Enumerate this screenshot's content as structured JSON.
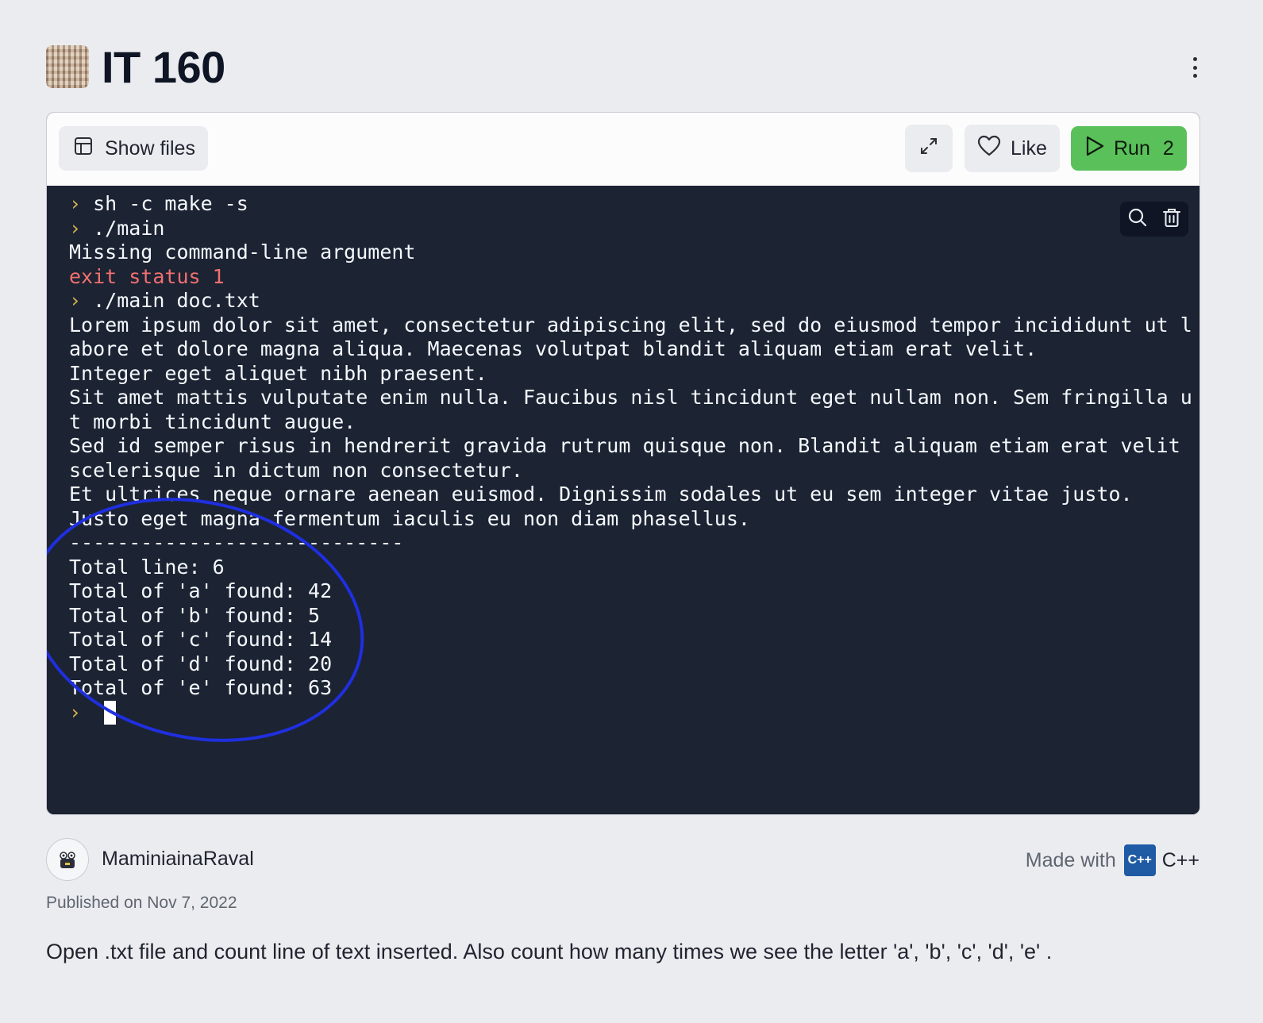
{
  "repl": {
    "title": "IT 160"
  },
  "toolbar": {
    "show_files_label": "Show files",
    "like_label": "Like",
    "run_label": "Run",
    "run_count": "2"
  },
  "terminal": {
    "lines": [
      {
        "type": "prompt",
        "text": "sh -c make -s"
      },
      {
        "type": "prompt",
        "text": "./main"
      },
      {
        "type": "out",
        "text": "Missing command-line argument"
      },
      {
        "type": "err",
        "text": "exit status 1"
      },
      {
        "type": "prompt",
        "text": "./main doc.txt"
      },
      {
        "type": "out",
        "text": "Lorem ipsum dolor sit amet, consectetur adipiscing elit, sed do eiusmod tempor incididunt ut l"
      },
      {
        "type": "out",
        "text": "abore et dolore magna aliqua. Maecenas volutpat blandit aliquam etiam erat velit."
      },
      {
        "type": "out",
        "text": "Integer eget aliquet nibh praesent."
      },
      {
        "type": "out",
        "text": "Sit amet mattis vulputate enim nulla. Faucibus nisl tincidunt eget nullam non. Sem fringilla u"
      },
      {
        "type": "out",
        "text": "t morbi tincidunt augue."
      },
      {
        "type": "out",
        "text": "Sed id semper risus in hendrerit gravida rutrum quisque non. Blandit aliquam etiam erat velit"
      },
      {
        "type": "out",
        "text": "scelerisque in dictum non consectetur."
      },
      {
        "type": "out",
        "text": "Et ultrices neque ornare aenean euismod. Dignissim sodales ut eu sem integer vitae justo."
      },
      {
        "type": "out",
        "text": "Justo eget magna fermentum iaculis eu non diam phasellus."
      },
      {
        "type": "out",
        "text": "----------------------------"
      },
      {
        "type": "out",
        "text": "Total line: 6"
      },
      {
        "type": "out",
        "text": "Total of 'a' found: 42"
      },
      {
        "type": "out",
        "text": "Total of 'b' found: 5"
      },
      {
        "type": "out",
        "text": "Total of 'c' found: 14"
      },
      {
        "type": "out",
        "text": "Total of 'd' found: 20"
      },
      {
        "type": "out",
        "text": "Total of 'e' found: 63"
      },
      {
        "type": "cursor",
        "text": ""
      }
    ]
  },
  "author": {
    "name": "MaminiainaRaval"
  },
  "made_with": {
    "label": "Made with",
    "language": "C++",
    "icon_text": "C++"
  },
  "published": "Published on Nov 7, 2022",
  "description": "Open .txt file and count line of text inserted. Also count how many times we see the letter 'a', 'b', 'c', 'd', 'e' .",
  "colors": {
    "background": "#ebecef",
    "terminal_bg": "#1c2333",
    "run_button": "#5ac05a",
    "prompt_glyph": "#d4b24c",
    "error_text": "#f2706f",
    "annotation_circle": "#1f2fe0"
  }
}
